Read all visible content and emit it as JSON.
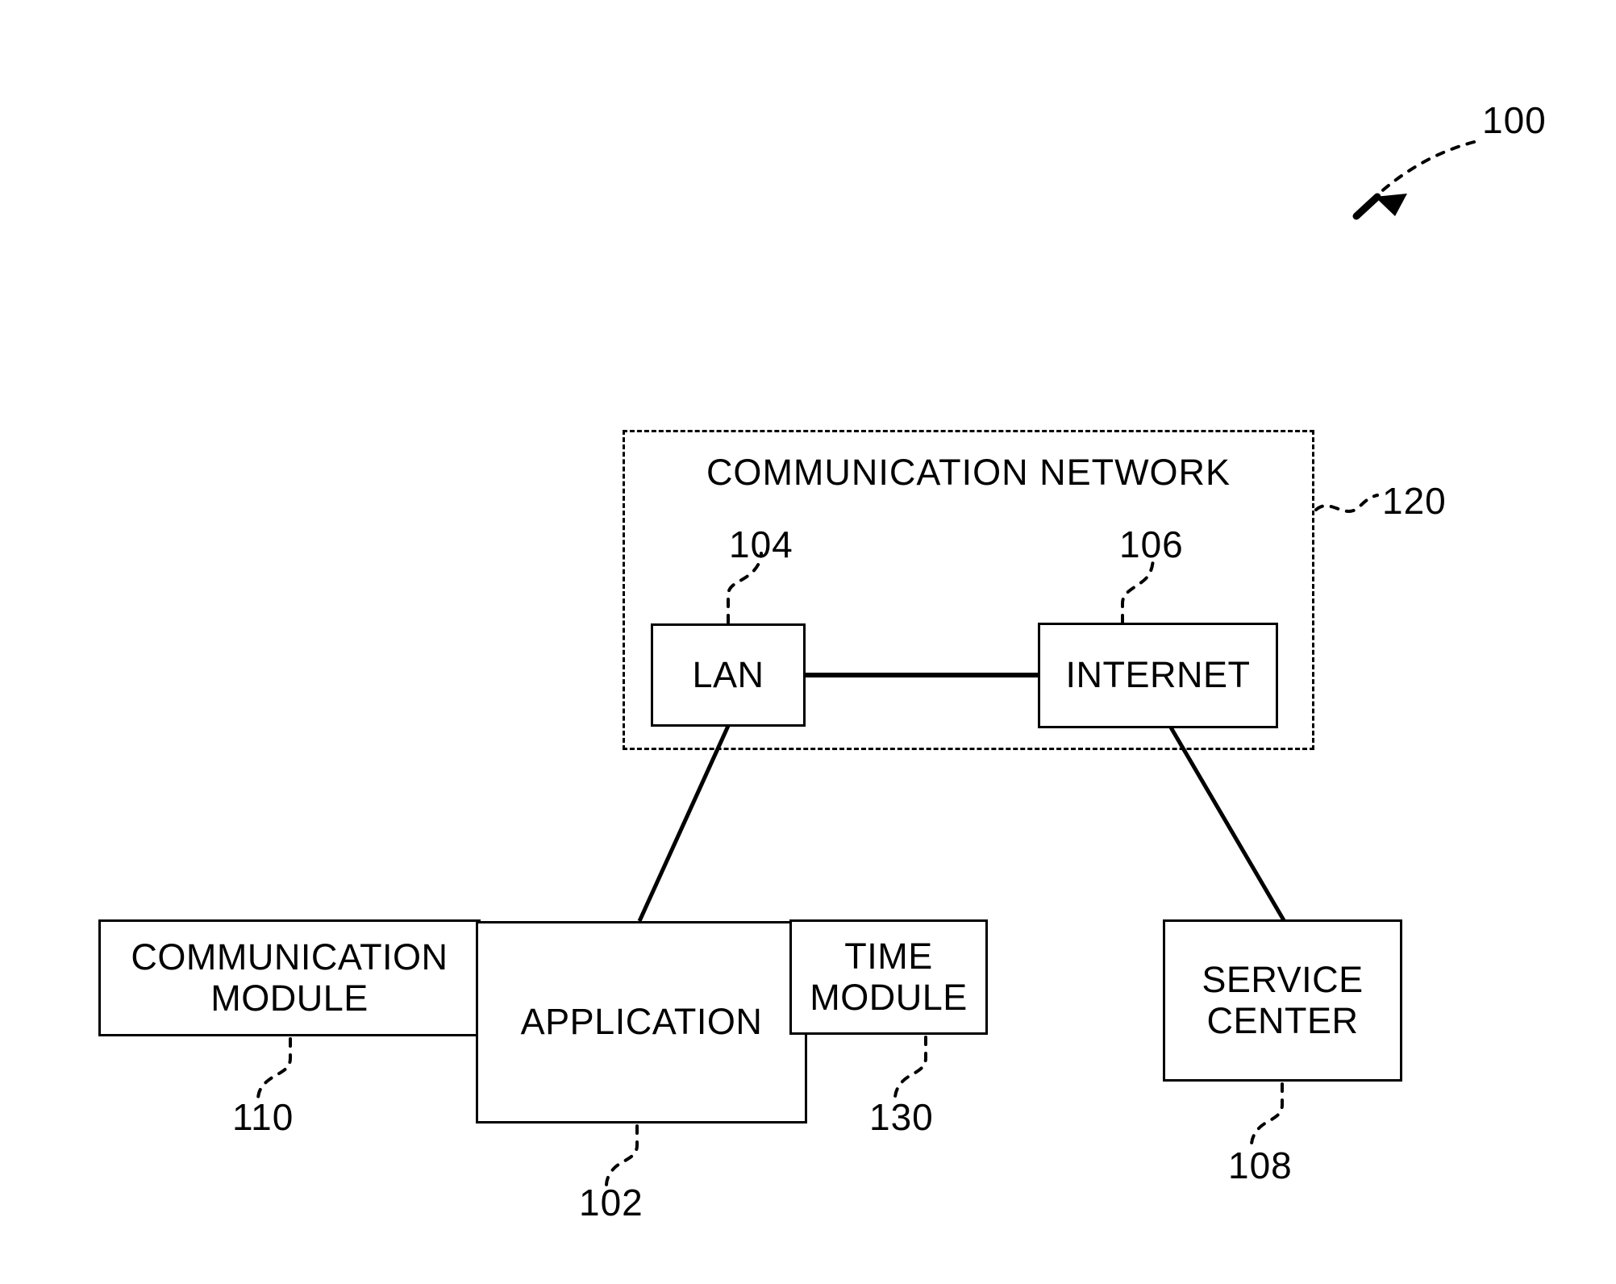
{
  "figure": {
    "figure_number": "100",
    "background_color": "#ffffff",
    "line_color": "#000000"
  },
  "region": {
    "title": "COMMUNICATION NETWORK",
    "ref": "120"
  },
  "nodes": {
    "lan": {
      "label": "LAN",
      "ref": "104"
    },
    "internet": {
      "label": "INTERNET",
      "ref": "106"
    },
    "communication_module": {
      "label": "COMMUNICATION\nMODULE",
      "line1": "COMMUNICATION",
      "line2": "MODULE",
      "ref": "110"
    },
    "application": {
      "label": "APPLICATION",
      "ref": "102"
    },
    "time_module": {
      "line1": "TIME",
      "line2": "MODULE",
      "ref": "130"
    },
    "service_center": {
      "line1": "SERVICE",
      "line2": "CENTER",
      "ref": "108"
    }
  },
  "refs": {
    "figure": "100",
    "region": "120",
    "lan": "104",
    "internet": "106",
    "communication_module": "110",
    "application": "102",
    "time_module": "130",
    "service_center": "108"
  },
  "connections": [
    {
      "from": "lan",
      "to": "internet",
      "style": "solid"
    },
    {
      "from": "lan",
      "to": "application",
      "style": "solid"
    },
    {
      "from": "internet",
      "to": "service_center",
      "style": "solid"
    },
    {
      "from": "communication_module",
      "to": "application",
      "style": "adjacent"
    },
    {
      "from": "application",
      "to": "time_module",
      "style": "adjacent"
    }
  ]
}
